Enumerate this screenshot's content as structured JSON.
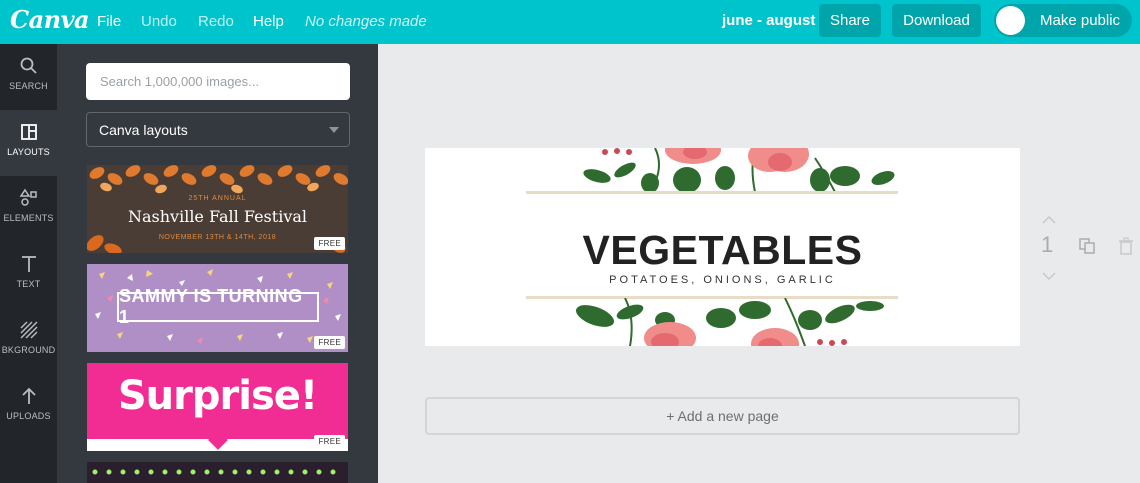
{
  "topbar": {
    "logo": "Canva",
    "menu": {
      "file": "File",
      "undo": "Undo",
      "redo": "Redo",
      "help": "Help"
    },
    "status": "No changes made",
    "doc_title": "june - august",
    "share": "Share",
    "download": "Download",
    "make_public": "Make public"
  },
  "rail": {
    "search": "SEARCH",
    "layouts": "LAYOUTS",
    "elements": "ELEMENTS",
    "text": "TEXT",
    "background": "BKGROUND",
    "uploads": "UPLOADS"
  },
  "panel": {
    "search_placeholder": "Search 1,000,000 images...",
    "layout_select": "Canva layouts",
    "free_badge": "FREE",
    "thumbs": [
      {
        "sub": "25TH ANNUAL",
        "title": "Nashville Fall Festival",
        "date": "NOVEMBER 13TH & 14TH, 2018"
      },
      {
        "title": "SAMMY IS TURNING 1"
      },
      {
        "title": "Surprise!"
      }
    ]
  },
  "design": {
    "title": "VEGETABLES",
    "subtitle": "POTATOES, ONIONS, GARLIC"
  },
  "page_controls": {
    "page_number": "1"
  },
  "add_page": "+ Add a new page",
  "colors": {
    "brand": "#00c4cc",
    "brand_dark": "#00a5ac",
    "rail": "#22262a",
    "panel": "#34393f",
    "flower_pink": "#f08c8a",
    "leaf_green": "#2f6b2f"
  }
}
